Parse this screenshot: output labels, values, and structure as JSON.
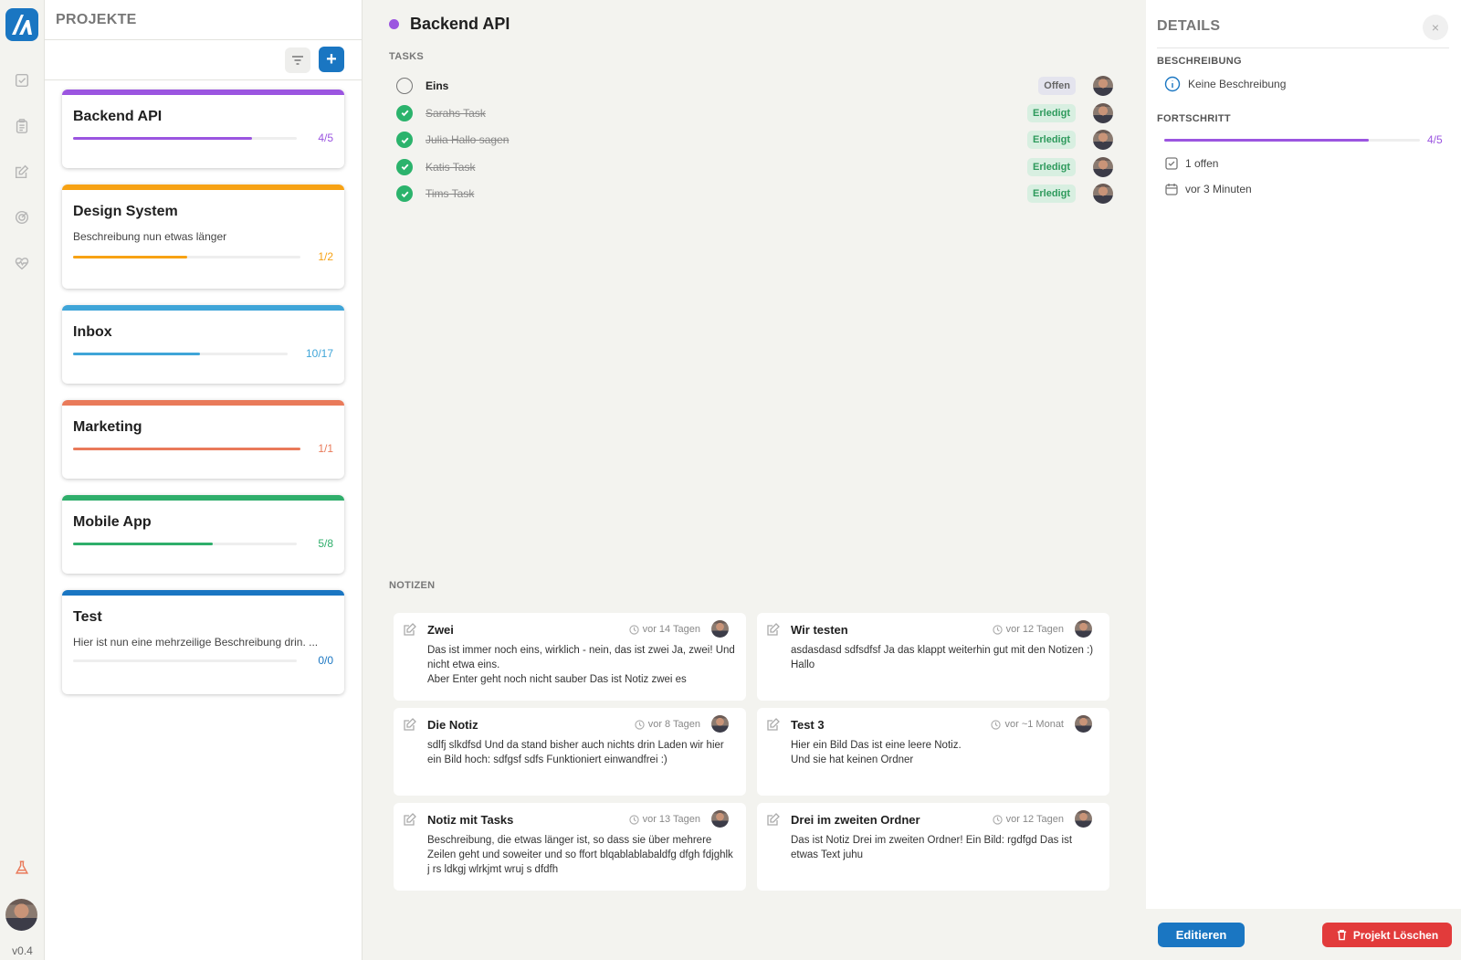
{
  "app": {
    "version": "v0.4",
    "accent": "#1a76c2"
  },
  "rail": {
    "icons": [
      "tasks-icon",
      "clipboard-icon",
      "notes-icon",
      "focus-icon",
      "health-icon"
    ],
    "lab_icon": "flask-icon"
  },
  "projects_panel": {
    "title": "PROJEKTE",
    "filter_icon": "filter-icon",
    "add_label": "+"
  },
  "projects": [
    {
      "name": "Backend API",
      "description": "",
      "progress": 0.8,
      "count": "4/5",
      "color": "#9b55e0"
    },
    {
      "name": "Design System",
      "description": "Beschreibung nun etwas länger",
      "progress": 0.5,
      "count": "1/2",
      "color": "#f7a214"
    },
    {
      "name": "Inbox",
      "description": "",
      "progress": 0.59,
      "count": "10/17",
      "color": "#3fa5d8"
    },
    {
      "name": "Marketing",
      "description": "",
      "progress": 1.0,
      "count": "1/1",
      "color": "#e97a5a"
    },
    {
      "name": "Mobile App",
      "description": "",
      "progress": 0.625,
      "count": "5/8",
      "color": "#2fae6b"
    },
    {
      "name": "Test",
      "description": "Hier ist nun eine mehrzeilige Beschreibung drin. ...",
      "progress": 0.0,
      "count": "0/0",
      "color": "#1a76c2"
    }
  ],
  "main": {
    "title": "Backend API",
    "color": "#9b55e0",
    "tasks_label": "TASKS",
    "notes_label": "NOTIZEN",
    "tasks": [
      {
        "name": "Eins",
        "status": "Offen",
        "done": false
      },
      {
        "name": "Sarahs Task",
        "status": "Erledigt",
        "done": true
      },
      {
        "name": "Julia Hallo sagen",
        "status": "Erledigt",
        "done": true
      },
      {
        "name": "Katis Task",
        "status": "Erledigt",
        "done": true
      },
      {
        "name": "Tims Task",
        "status": "Erledigt",
        "done": true
      }
    ],
    "notes": [
      {
        "title": "Zwei",
        "time": "vor 14 Tagen",
        "body": "Das ist immer noch eins, wirklich - nein, das ist zwei Ja, zwei! Und nicht etwa eins.\nAber Enter geht noch nicht sauber Das ist Notiz zwei es"
      },
      {
        "title": "Wir testen",
        "time": "vor 12 Tagen",
        "body": "asdasdasd sdfsdfsf Ja das klappt weiterhin gut mit den Notizen :) Hallo"
      },
      {
        "title": "Die Notiz",
        "time": "vor 8 Tagen",
        "body": "sdlfj slkdfsd Und da stand bisher auch nichts drin Laden wir hier ein Bild hoch: sdfgsf sdfs Funktioniert einwandfrei :)"
      },
      {
        "title": "Test 3",
        "time": "vor ~1 Monat",
        "body": "Hier ein Bild Das ist eine leere Notiz.\nUnd sie hat keinen Ordner"
      },
      {
        "title": "Notiz mit Tasks",
        "time": "vor 13 Tagen",
        "body": "Beschreibung, die etwas länger ist, so dass sie über mehrere Zeilen geht und soweiter und so ffort blqablablabaldfg dfgh fdjghlk j rs ldkgj wlrkjmt wruj s dfdfh"
      },
      {
        "title": "Drei im zweiten Ordner",
        "time": "vor 12 Tagen",
        "body": "Das ist Notiz Drei im zweiten Ordner! Ein Bild: rgdfgd Das ist etwas Text juhu"
      }
    ]
  },
  "details": {
    "title": "DETAILS",
    "close_label": "×",
    "description_label": "BESCHREIBUNG",
    "description_value": "Keine Beschreibung",
    "progress_label": "FORTSCHRITT",
    "progress": 0.8,
    "progress_count": "4/5",
    "open_text": "1 offen",
    "created_text": "vor 3 Minuten",
    "edit_label": "Editieren",
    "delete_label": "Projekt Löschen",
    "delete_color": "#e23b3b"
  }
}
